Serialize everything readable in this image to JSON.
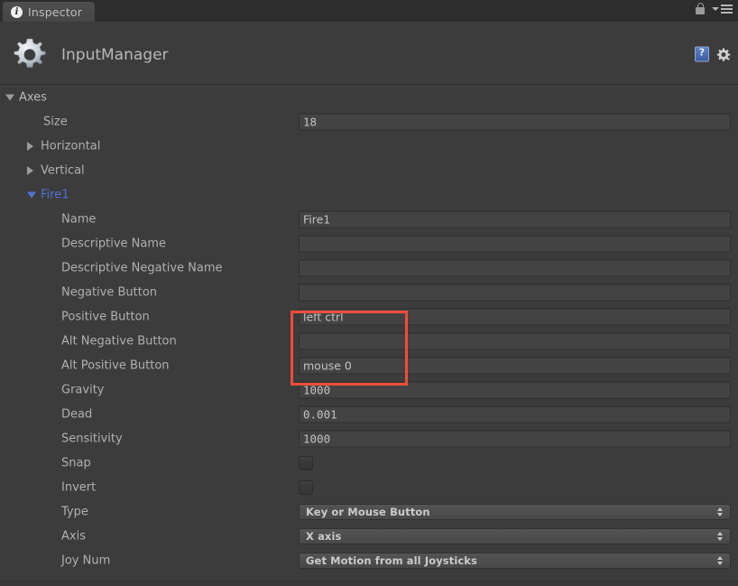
{
  "window": {
    "tab_label": "Inspector",
    "tab_icon": "info-icon",
    "lock_icon": "lock-icon",
    "menu_icon": "hamburger-menu-icon",
    "accent_blue": "#4f72d8",
    "annotation_color": "#f04d3c",
    "background": "#3c3c3c"
  },
  "object_header": {
    "icon": "gear-icon",
    "title": "InputManager",
    "help_icon": "help-book-icon",
    "settings_icon": "gear-settings-icon"
  },
  "inspector": {
    "rows": [
      {
        "label": "Axes",
        "indent": 8,
        "type": "foldout",
        "expanded": true,
        "style": "header"
      },
      {
        "label": "Size",
        "indent": 48,
        "type": "int",
        "value": "18"
      },
      {
        "label": "Horizontal",
        "indent": 32,
        "type": "foldout",
        "expanded": false
      },
      {
        "label": "Vertical",
        "indent": 32,
        "type": "foldout",
        "expanded": false
      },
      {
        "label": "Fire1",
        "indent": 32,
        "type": "foldout",
        "expanded": true,
        "style": "selected"
      },
      {
        "label": "Name",
        "indent": 68,
        "type": "text",
        "value": "Fire1"
      },
      {
        "label": "Descriptive Name",
        "indent": 68,
        "type": "text",
        "value": ""
      },
      {
        "label": "Descriptive Negative Name",
        "indent": 68,
        "type": "text",
        "value": ""
      },
      {
        "label": "Negative Button",
        "indent": 68,
        "type": "text",
        "value": ""
      },
      {
        "label": "Positive Button",
        "indent": 68,
        "type": "text",
        "value": "left ctrl"
      },
      {
        "label": "Alt Negative Button",
        "indent": 68,
        "type": "text",
        "value": ""
      },
      {
        "label": "Alt Positive Button",
        "indent": 68,
        "type": "text",
        "value": "mouse 0"
      },
      {
        "label": "Gravity",
        "indent": 68,
        "type": "float",
        "value": "1000"
      },
      {
        "label": "Dead",
        "indent": 68,
        "type": "float",
        "value": "0.001"
      },
      {
        "label": "Sensitivity",
        "indent": 68,
        "type": "float",
        "value": "1000"
      },
      {
        "label": "Snap",
        "indent": 68,
        "type": "toggle",
        "checked": false
      },
      {
        "label": "Invert",
        "indent": 68,
        "type": "toggle",
        "checked": false
      },
      {
        "label": "Type",
        "indent": 68,
        "type": "dropdown",
        "value": "Key or Mouse Button"
      },
      {
        "label": "Axis",
        "indent": 68,
        "type": "dropdown",
        "value": "X axis"
      },
      {
        "label": "Joy Num",
        "indent": 68,
        "type": "dropdown",
        "value": "Get Motion from all Joysticks"
      }
    ]
  }
}
